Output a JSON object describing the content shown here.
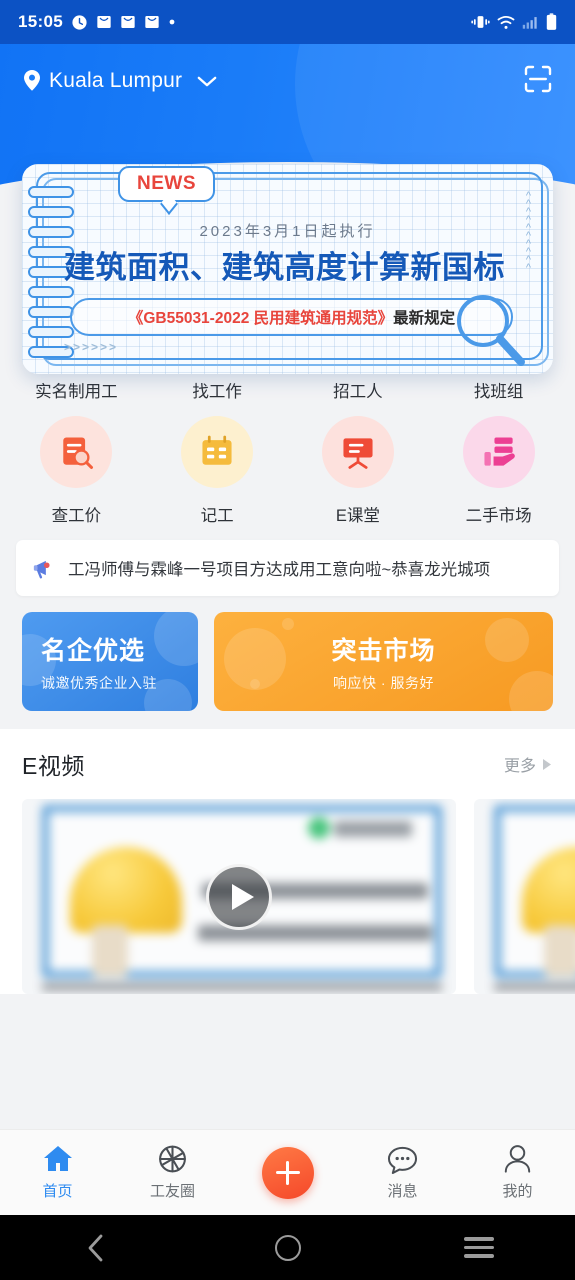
{
  "status_bar": {
    "time": "15:05",
    "left_icons": [
      "alarm-icon",
      "mail-icon",
      "mail-icon",
      "mail-icon",
      "dot-icon"
    ],
    "right_icons": [
      "vibrate-icon",
      "wifi-icon",
      "signal-icon",
      "battery-icon"
    ]
  },
  "header": {
    "location": "Kuala Lumpur",
    "dropdown_icon": "chevron-down-icon",
    "location_icon": "map-pin-icon",
    "scan_icon": "scan-qr-icon",
    "bg_color": "#1a7cf8"
  },
  "banner": {
    "badge": "NEWS",
    "date_line": "2023年3月1日起执行",
    "title": "建筑面积、建筑高度计算新国标",
    "standard": "《GB55031-2022 民用建筑通用规范》",
    "standard_suffix": "最新规定",
    "decor_arrows": ">>>>>>",
    "title_color": "#1559b8",
    "accent_color": "#e8453c"
  },
  "grid": {
    "rows": [
      [
        {
          "label": "实名制用工",
          "icon": "id-card-check-icon",
          "bg": "#d6f5ef",
          "fg": "#21c2ad"
        },
        {
          "label": "找工作",
          "icon": "document-check-icon",
          "bg": "#d3e9fb",
          "fg": "#3d9bf0"
        },
        {
          "label": "招工人",
          "icon": "person-search-icon",
          "bg": "#fdeccd",
          "fg": "#f5b93f"
        },
        {
          "label": "找班组",
          "icon": "group-people-icon",
          "bg": "#e4dbfa",
          "fg": "#7a5ce0"
        }
      ],
      [
        {
          "label": "查工价",
          "icon": "price-search-icon",
          "bg": "#fde3dd",
          "fg": "#f4603c"
        },
        {
          "label": "记工",
          "icon": "calendar-icon",
          "bg": "#fdf0cf",
          "fg": "#f5bb3c"
        },
        {
          "label": "E课堂",
          "icon": "blackboard-icon",
          "bg": "#fde1dd",
          "fg": "#ef4b37"
        },
        {
          "label": "二手市场",
          "icon": "hand-goods-icon",
          "bg": "#fbd8ea",
          "fg": "#ec3f93"
        }
      ]
    ]
  },
  "notice": {
    "icon": "megaphone-icon",
    "text": "工冯师傅与霖峰一号项目方达成用工意向啦~恭喜龙光城项"
  },
  "promos": [
    {
      "title": "名企优选",
      "subtitle": "诚邀优秀企业入驻",
      "color": "#3f8ce8"
    },
    {
      "title": "突击市场",
      "subtitle": "响应快 · 服务好",
      "color": "#f9a42c"
    }
  ],
  "video_section": {
    "title": "E视频",
    "more_label": "更多",
    "more_icon": "chevron-right-icon",
    "play_icon": "play-icon",
    "cards": [
      {
        "name": "video-card"
      },
      {
        "name": "video-card"
      }
    ]
  },
  "tabbar": {
    "items": [
      {
        "label": "首页",
        "icon": "home-icon",
        "active": true
      },
      {
        "label": "工友圈",
        "icon": "aperture-icon",
        "active": false
      },
      {
        "label": "",
        "icon": "plus-fab-icon",
        "active": false
      },
      {
        "label": "消息",
        "icon": "chat-bubble-icon",
        "active": false
      },
      {
        "label": "我的",
        "icon": "person-icon",
        "active": false
      }
    ],
    "active_color": "#2e8bf0",
    "fab_color": "#f5482a"
  },
  "android_nav": {
    "back_icon": "chevron-left-icon",
    "home_icon": "circle-icon",
    "recents_icon": "hamburger-icon"
  }
}
